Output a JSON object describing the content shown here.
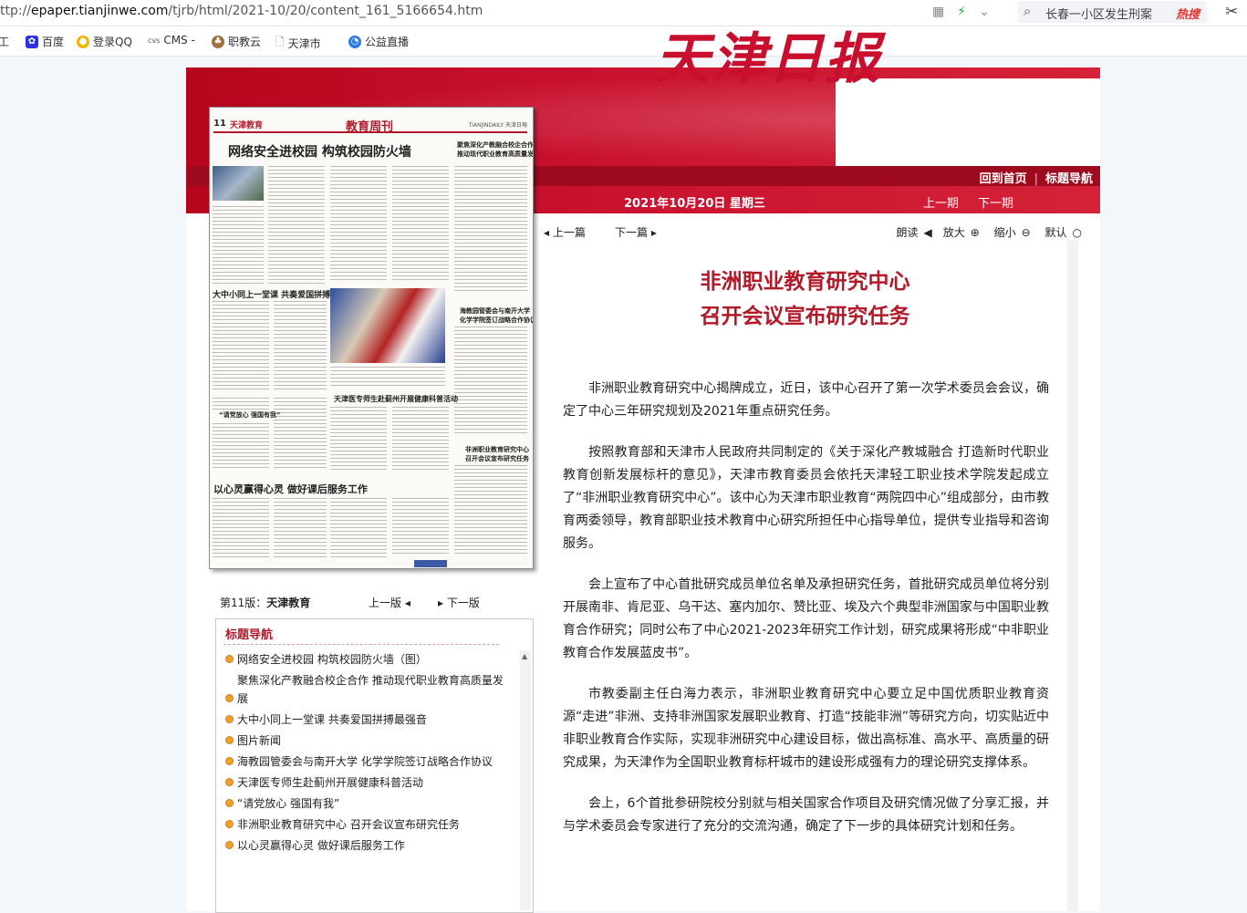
{
  "browser": {
    "url_prefix": "ttp://",
    "url_host": "epaper.tianjinwe.com",
    "url_path": "/tjrb/html/2021-10/20/content_161_5166654.htm",
    "search_query": "长春一小区发生刑案",
    "search_hot": "热搜",
    "bookmarks": [
      "工",
      "百度",
      "登录QQ",
      "CMS -",
      "职教云",
      "天津市",
      "公益直播"
    ]
  },
  "masthead": {
    "logo_text": "天津日报",
    "home_link": "回到首页",
    "nav_link": "标题导航",
    "date": "2021年10月20日  星期三",
    "prev_issue": "上一期",
    "next_issue": "下一期"
  },
  "thumbnail": {
    "page_number": "11",
    "section": "天津教育",
    "page_title": "教育周刊",
    "logo_small": "TIANJINDAILY 天津日報",
    "main_headline": "网络安全进校园  构筑校园防火墙",
    "side_headline_1": "聚焦深化产教融合校企合作",
    "side_headline_2": "推动现代职业教育高质量发展",
    "sub_1": "大中小同上一堂课  共奏爱国拼搏最强音",
    "sub_2": "海教园管委会与南开大学",
    "sub_3": "化学学院签订战略合作协议",
    "sub_4": "天津医专师生赴蓟州开展健康科普活动",
    "sub_5": "“请党放心  强国有我”",
    "sub_6": "非洲职业教育研究中心",
    "sub_7": "召开会议宣布研究任务",
    "bottom_headline": "以心灵赢得心灵  做好课后服务工作"
  },
  "page_nav": {
    "label_prefix": "第11版：",
    "label_name": "天津教育",
    "prev": "上一版",
    "next": "下一版"
  },
  "toc": {
    "title": "标题导航",
    "items": [
      "网络安全进校园 构筑校园防火墙（图）",
      "聚焦深化产教融合校企合作 推动现代职业教育高质量发展",
      "大中小同上一堂课 共奏爱国拼搏最强音",
      "图片新闻",
      "海教园管委会与南开大学 化学学院签订战略合作协议",
      "天津医专师生赴蓟州开展健康科普活动",
      "“请党放心 强国有我”",
      "非洲职业教育研究中心 召开会议宣布研究任务",
      "以心灵赢得心灵 做好课后服务工作"
    ]
  },
  "article_toolbar": {
    "prev": "上一篇",
    "next": "下一篇",
    "read": "朗读",
    "zoom_in": "放大",
    "zoom_out": "缩小",
    "default": "默认"
  },
  "article": {
    "title_line1": "非洲职业教育研究中心",
    "title_line2": "召开会议宣布研究任务",
    "paragraphs": [
      "非洲职业教育研究中心揭牌成立，近日，该中心召开了第一次学术委员会会议，确定了中心三年研究规划及2021年重点研究任务。",
      "按照教育部和天津市人民政府共同制定的《关于深化产教城融合  打造新时代职业教育创新发展标杆的意见》，天津市教育委员会依托天津轻工职业技术学院发起成立了“非洲职业教育研究中心”。该中心为天津市职业教育“两院四中心”组成部分，由市教育两委领导，教育部职业技术教育中心研究所担任中心指导单位，提供专业指导和咨询服务。",
      "会上宣布了中心首批研究成员单位名单及承担研究任务，首批研究成员单位将分别开展南非、肯尼亚、乌干达、塞内加尔、赞比亚、埃及六个典型非洲国家与中国职业教育合作研究；同时公布了中心2021-2023年研究工作计划，研究成果将形成“中非职业教育合作发展蓝皮书”。",
      "市教委副主任白海力表示，非洲职业教育研究中心要立足中国优质职业教育资源“走进”非洲、支持非洲国家发展职业教育、打造“技能非洲”等研究方向，切实贴近中非职业教育合作实际，实现非洲研究中心建设目标，做出高标准、高水平、高质量的研究成果，为天津作为全国职业教育标杆城市的建设形成强有力的理论研究支撑体系。",
      "会上，6个首批参研院校分别就与相关国家合作项目及研究情况做了分享汇报，并与学术委员会专家进行了充分的交流沟通，确定了下一步的具体研究计划和任务。"
    ]
  }
}
